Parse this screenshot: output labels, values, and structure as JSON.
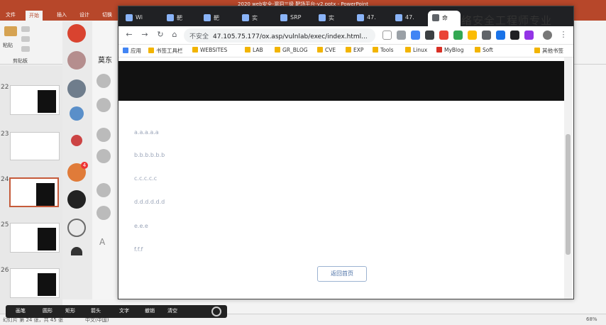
{
  "powerpoint": {
    "title": "2020 web安全-漏洞三级 靶场平台-v2.pptx - PowerPoint",
    "tabs": [
      "文件",
      "开始",
      "插入",
      "设计",
      "切换"
    ],
    "active_tab": "开始",
    "ribbon_labels": [
      "粘贴",
      "剪贴板"
    ],
    "slide_numbers": [
      "22",
      "23",
      "24",
      "25",
      "26"
    ],
    "status_left": "幻灯片 第 24 张，共 45 张",
    "status_lang": "中文(中国)",
    "zoom": "68%"
  },
  "chat": {
    "contact_name": "莫东",
    "unread_badge": "4"
  },
  "chrome": {
    "tabs": [
      "Wi",
      "靶",
      "靶",
      "实",
      "SRP",
      "实",
      "47.",
      "47.",
      "命"
    ],
    "address_insecure": "不安全",
    "address_url": "47.105.75.177/ox.asp/vulnlab/exec/index.html...",
    "bookmarks": [
      "应用",
      "书签工具栏",
      "WEBSITES",
      "LAB",
      "GR_BLOG",
      "CVE",
      "EXP",
      "Tools",
      "Linux",
      "MyBlog",
      "Soft",
      "其他书签"
    ]
  },
  "page": {
    "links": [
      "a.a.a.a.a",
      "b.b.b.b.b.b",
      "c.c.c.c.c",
      "d.d.d.d.d.d",
      "e.e.e",
      "f.f.f"
    ],
    "return_button": "返回首页"
  },
  "overlay": {
    "title": "络安全工程师专业"
  },
  "recorder": {
    "buttons": [
      "画笔",
      "圆形",
      "矩形",
      "箭头",
      "文字",
      "撤销",
      "清空"
    ]
  },
  "colors": {
    "ppt_accent": "#b7472a",
    "chrome_dark": "#202124",
    "banner": "#111111"
  }
}
